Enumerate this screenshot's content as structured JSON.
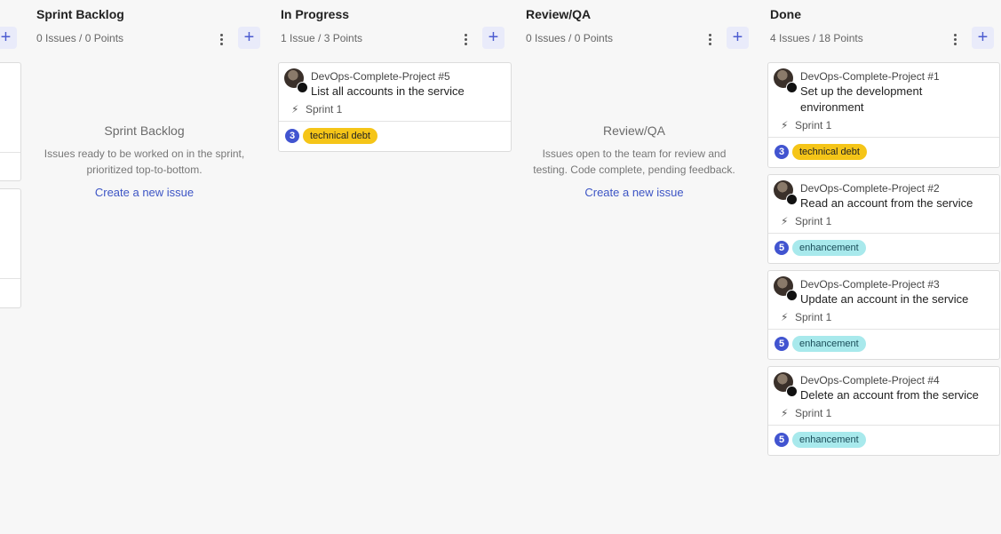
{
  "columns": [
    {
      "title": "Sprint Backlog",
      "count": "0 Issues / 0 Points",
      "empty": {
        "title": "Sprint Backlog",
        "desc_line1": "Issues ready to be worked on in the sprint,",
        "desc_line2": "prioritized top-to-bottom.",
        "link": "Create a new issue"
      }
    },
    {
      "title": "In Progress",
      "count": "1 Issue / 3 Points"
    },
    {
      "title": "Review/QA",
      "count": "0 Issues / 0 Points",
      "empty": {
        "title": "Review/QA",
        "desc_line1": "Issues open to the team for review and",
        "desc_line2": "testing. Code complete, pending feedback.",
        "link": "Create a new issue"
      }
    },
    {
      "title": "Done",
      "count": "4 Issues / 18 Points"
    }
  ],
  "cards": [
    {
      "project": "DevOps-Complete-Project #5",
      "title": "List all accounts in the service",
      "sprint": "Sprint 1",
      "points": "3",
      "label": "technical debt"
    },
    {
      "project": "DevOps-Complete-Project #1",
      "title_line1": "Set up the development",
      "title_line2": "environment",
      "sprint": "Sprint 1",
      "points": "3",
      "label": "technical debt"
    },
    {
      "project": "DevOps-Complete-Project #2",
      "title": "Read an account from the service",
      "sprint": "Sprint 1",
      "points": "5",
      "label": "enhancement"
    },
    {
      "project": "DevOps-Complete-Project #3",
      "title": "Update an account in the service",
      "sprint": "Sprint 1",
      "points": "5",
      "label": "enhancement"
    },
    {
      "project": "DevOps-Complete-Project #4",
      "title": "Delete an account from the service",
      "sprint": "Sprint 1",
      "points": "5",
      "label": "enhancement"
    }
  ],
  "icons": {
    "add": "plus-icon",
    "menu": "kebab-menu-icon",
    "sprint": "lightning-icon",
    "avatar": "github-avatar"
  },
  "colors": {
    "accent": "#4154d0",
    "label_technical_debt": "#f5c518",
    "label_enhancement": "#a8e9ec",
    "link": "#3d55c5"
  },
  "glyphs": {
    "plus": "+",
    "bolt": "⚡"
  }
}
